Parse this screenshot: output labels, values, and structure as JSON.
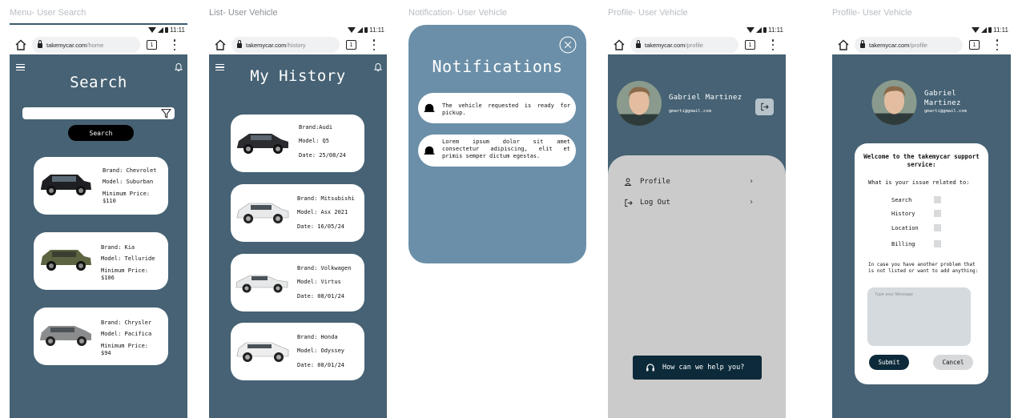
{
  "frames": {
    "search": {
      "label": "Menu- User Search",
      "status_time": "11:11",
      "url": {
        "host": "takemycar.com",
        "path": "/home"
      },
      "tab_count": "1",
      "title": "Search",
      "search": {
        "value": "",
        "button_label": "Search"
      },
      "cars": [
        {
          "brand": "Brand: Chevrolet",
          "model": "Model: Suburban",
          "price_label": "Minimum Price:",
          "price": "$110",
          "color": "#1d1f22"
        },
        {
          "brand": "Brand: Kia",
          "model": "Model: Telluride",
          "price_label": "Minimum Price:",
          "price": "$106",
          "color": "#5d6442"
        },
        {
          "brand": "Brand: Chrysler",
          "model": "Model: Pacifica",
          "price_label": "Minimum Price:",
          "price": "$94",
          "color": "#8a8c8e"
        }
      ]
    },
    "history": {
      "label": "List- User Vehicle",
      "status_time": "11:11",
      "url": {
        "host": "takemycar.com",
        "path": "/history"
      },
      "tab_count": "1",
      "title": "My History",
      "items": [
        {
          "brand": "Brand:Audi",
          "model": "Model: Q5",
          "date": "Date: 25/08/24",
          "color": "#2a2c30"
        },
        {
          "brand": "Brand: Mitsubishi",
          "model": "Model: Asx 2021",
          "date": "Date: 16/05/24",
          "color": "#e8e9ea"
        },
        {
          "brand": "Brand: Volkwagen",
          "model": "Model: Virtus",
          "date": "Date: 08/01/24",
          "color": "#e6e7e8"
        },
        {
          "brand": "Brand: Honda",
          "model": "Model: Odyssey",
          "date": "Date: 08/01/24",
          "color": "#eeeeef"
        }
      ]
    },
    "notifications": {
      "label": "Notification- User Vehicle",
      "title": "Notifications",
      "items": [
        {
          "text": "The vehicle requested is ready for pickup."
        },
        {
          "text": "Lorem ipsum dolor sit amet consectetur adipiscing, elit et primis semper dictum egestas."
        }
      ]
    },
    "profile": {
      "label": "Profile- User Vehicle",
      "status_time": "11:11",
      "url": {
        "host": "takemycar.com",
        "path": "/profile"
      },
      "tab_count": "1",
      "user": {
        "name": "Gabriel Martinez",
        "email": "gmarti@gmail.com"
      },
      "menu": [
        {
          "label": "Profile",
          "icon": "user-icon"
        },
        {
          "label": "Log Out",
          "icon": "logout-icon"
        }
      ],
      "help_button": "How can we help you?"
    },
    "support": {
      "label": "Profile- User Vehicle",
      "status_time": "11:11",
      "url": {
        "host": "takemycar.com",
        "path": "/profile"
      },
      "tab_count": "1",
      "user": {
        "name_line1": "Gabriel",
        "name_line2": "Martinez",
        "email": "gmarti@gmail.com"
      },
      "heading": "Welcome to the takemycar support service:",
      "question": "What is your issue related to:",
      "options": [
        "Search",
        "History",
        "Location",
        "Billing"
      ],
      "other_text": "In case you have another problem that is not listed or want to add anything:",
      "message_placeholder": "Type your Message",
      "submit_label": "Submit",
      "cancel_label": "Cancel"
    }
  },
  "colors": {
    "primary": "#466274",
    "notif_bg": "#6b8fa8",
    "dark_button": "#0c2a3a",
    "profile_sheet": "#cbcbcb"
  }
}
